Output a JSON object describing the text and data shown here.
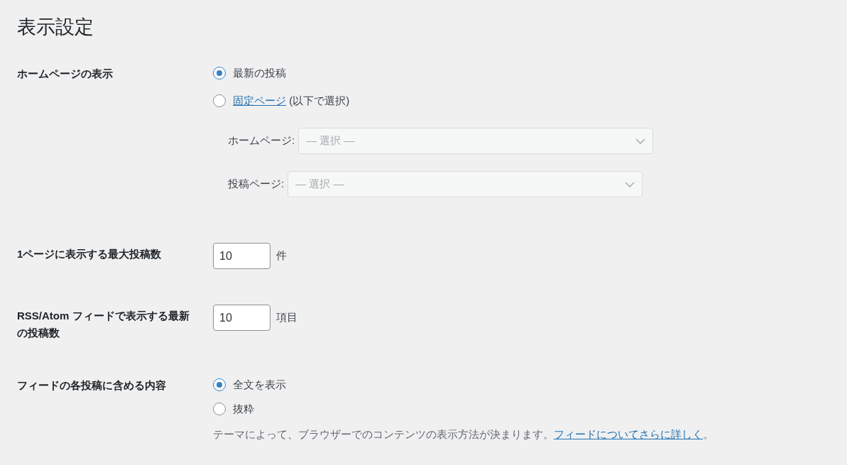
{
  "title": "表示設定",
  "homepage_display": {
    "label": "ホームページの表示",
    "options": [
      {
        "text": "最新の投稿",
        "selected": true
      },
      {
        "link": "固定ページ",
        "text": " (以下で選択)",
        "selected": false
      }
    ],
    "selects": [
      {
        "label": "ホームページ:",
        "placeholder": "— 選択 —",
        "disabled": true
      },
      {
        "label": "投稿ページ:",
        "placeholder": "— 選択 —",
        "disabled": true
      }
    ]
  },
  "posts_per_page": {
    "label": "1ページに表示する最大投稿数",
    "value": "10",
    "unit": "件"
  },
  "feed_items": {
    "label": "RSS/Atom フィードで表示する最新の投稿数",
    "value": "10",
    "unit": "項目"
  },
  "feed_content": {
    "label": "フィードの各投稿に含める内容",
    "options": [
      {
        "text": "全文を表示",
        "selected": true
      },
      {
        "text": "抜粋",
        "selected": false
      }
    ],
    "description": {
      "text": "テーマによって、ブラウザーでのコンテンツの表示方法が決まります。",
      "link": "フィードについてさらに詳しく",
      "after": "。"
    }
  }
}
